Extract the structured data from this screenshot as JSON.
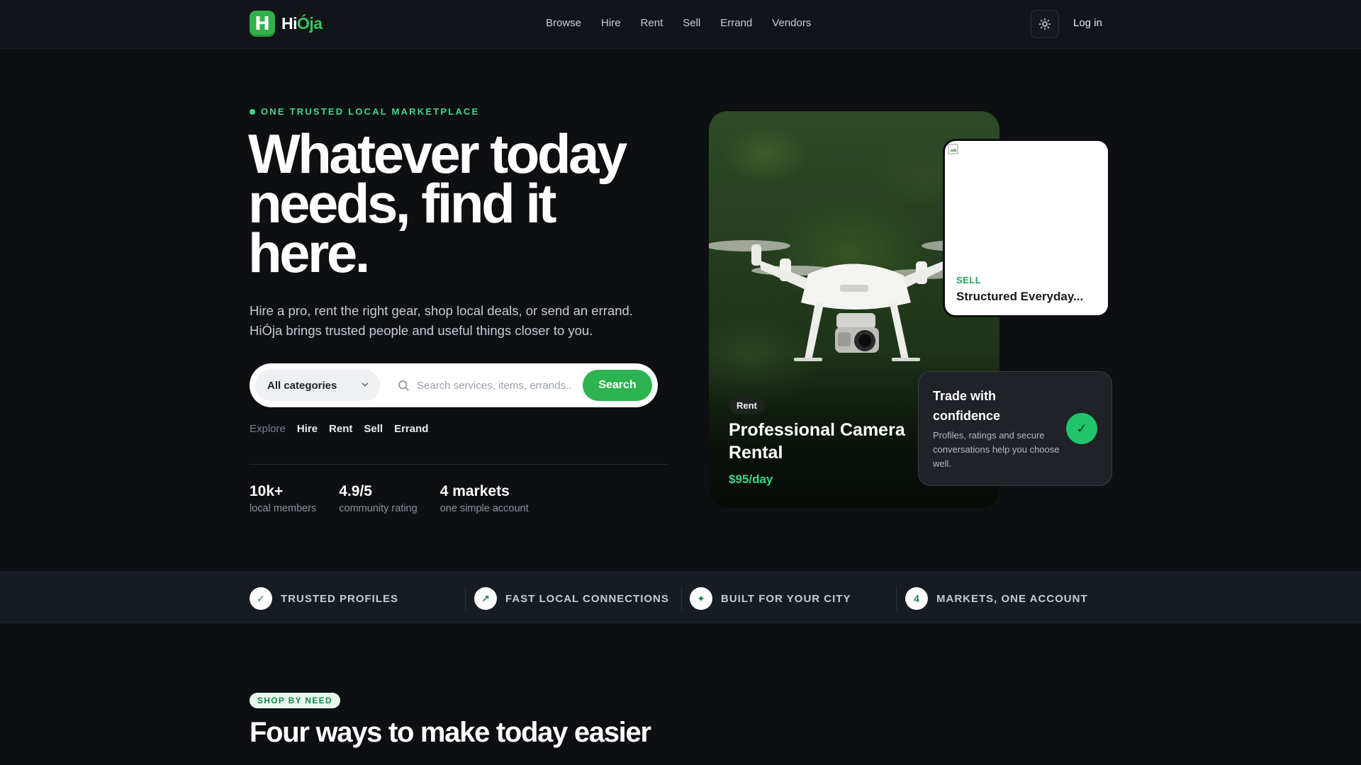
{
  "brand": {
    "logo_letter": "H",
    "name_part1": "Hi",
    "name_part2": "Ója",
    "accent_color": "#2fb24c"
  },
  "nav": {
    "links": [
      "Browse",
      "Hire",
      "Rent",
      "Sell",
      "Errand",
      "Vendors"
    ],
    "theme_icon": "sun-icon",
    "login": "Log in"
  },
  "hero": {
    "eyebrow": "ONE TRUSTED LOCAL MARKETPLACE",
    "headline": "Whatever today needs, find it here.",
    "subtext": "Hire a pro, rent the right gear, shop local deals, or send an errand. HiÓja brings trusted people and useful things closer to you.",
    "search": {
      "category_value": "All categories",
      "placeholder": "Search services, items, errands...",
      "button": "Search"
    },
    "explore": {
      "label": "Explore",
      "links": [
        "Hire",
        "Rent",
        "Sell",
        "Errand"
      ]
    },
    "stats": [
      {
        "value": "10k+",
        "label": "local members"
      },
      {
        "value": "4.9/5",
        "label": "community rating"
      },
      {
        "value": "4 markets",
        "label": "one simple account"
      }
    ]
  },
  "featured_card": {
    "badge": "Rent",
    "title": "Professional Camera Rental",
    "price": "$95/day"
  },
  "sell_card": {
    "tag": "SELL",
    "title": "Structured Everyday..."
  },
  "trust_card": {
    "title": "Trade with confidence",
    "body": "Profiles, ratings and secure conversations help you choose well.",
    "icon": "check-icon"
  },
  "features": [
    {
      "icon": "✓",
      "label": "TRUSTED PROFILES"
    },
    {
      "icon": "↗",
      "label": "FAST LOCAL CONNECTIONS"
    },
    {
      "icon": "✦",
      "label": "BUILT FOR YOUR CITY"
    },
    {
      "icon": "4",
      "label": "MARKETS, ONE ACCOUNT"
    }
  ],
  "section": {
    "pill": "SHOP BY NEED",
    "title": "Four ways to make today easier"
  }
}
